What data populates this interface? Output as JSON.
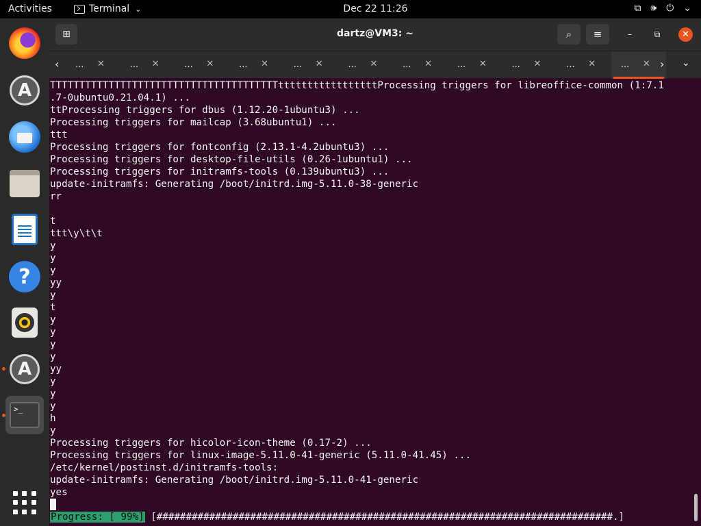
{
  "topbar": {
    "activities": "Activities",
    "app_name": "Terminal",
    "clock": "Dec 22  11:26",
    "tray": {
      "network": "⧉",
      "volume": "🕪",
      "power": "⏻",
      "menu": "⌄"
    }
  },
  "dock": {
    "items": [
      {
        "name": "firefox-icon",
        "running": false
      },
      {
        "name": "software-center-icon",
        "running": false
      },
      {
        "name": "thunderbird-icon",
        "running": false
      },
      {
        "name": "files-icon",
        "running": false
      },
      {
        "name": "libreoffice-writer-icon",
        "running": false
      },
      {
        "name": "help-icon",
        "running": false
      },
      {
        "name": "rhythmbox-icon",
        "running": false
      },
      {
        "name": "software-updater-icon",
        "running": true
      },
      {
        "name": "terminal-icon",
        "running": true
      },
      {
        "name": "show-apps-grid-icon",
        "running": false
      }
    ],
    "terminal_glyph": ">_",
    "software_glyph": "A",
    "help_glyph": "?"
  },
  "window": {
    "title": "dartz@VM3: ~",
    "new_tab_glyph": "⊞",
    "search_glyph": "⌕",
    "menu_glyph": "≡",
    "min_glyph": "–",
    "max_glyph": "⧉",
    "close_glyph": "✕"
  },
  "tabs": {
    "prev_glyph": "‹",
    "next_glyph": "›",
    "overflow_glyph": "⌄",
    "items": [
      {
        "label": "...",
        "close": "✕"
      },
      {
        "label": "...",
        "close": "✕"
      },
      {
        "label": "...",
        "close": "✕"
      },
      {
        "label": "...",
        "close": "✕"
      },
      {
        "label": "...",
        "close": "✕"
      },
      {
        "label": "...",
        "close": "✕"
      },
      {
        "label": "...",
        "close": "✕"
      },
      {
        "label": "...",
        "close": "✕"
      },
      {
        "label": "...",
        "close": "✕"
      },
      {
        "label": "...",
        "close": "✕"
      },
      {
        "label": "...",
        "close": "✕"
      }
    ],
    "active_index": 10
  },
  "terminal": {
    "lines": [
      "TTTTTTTTTTTTTTTTTTTTTTTTTTTTTTTTTTTTTTTtttttttttttttttttProcessing triggers for libreoffice-common (1:7.1",
      ".7-0ubuntu0.21.04.1) ...",
      "ttProcessing triggers for dbus (1.12.20-1ubuntu3) ...",
      "Processing triggers for mailcap (3.68ubuntu1) ...",
      "ttt",
      "Processing triggers for fontconfig (2.13.1-4.2ubuntu3) ...",
      "Processing triggers for desktop-file-utils (0.26-1ubuntu1) ...",
      "Processing triggers for initramfs-tools (0.139ubuntu3) ...",
      "update-initramfs: Generating /boot/initrd.img-5.11.0-38-generic",
      "rr",
      "",
      "t",
      "ttt\\y\\t\\t",
      "y",
      "y",
      "y",
      "yy",
      "y",
      "t",
      "y",
      "y",
      "y",
      "y",
      "yy",
      "y",
      "y",
      "y",
      "h",
      "y",
      "Processing triggers for hicolor-icon-theme (0.17-2) ...",
      "Processing triggers for linux-image-5.11.0-41-generic (5.11.0-41.45) ...",
      "/etc/kernel/postinst.d/initramfs-tools:",
      "update-initramfs: Generating /boot/initrd.img-5.11.0-41-generic",
      "yes"
    ],
    "progress_label": "Progress: [ 99%]",
    "progress_bar": " [##############################################################################.]",
    "progress_percent": 99
  }
}
